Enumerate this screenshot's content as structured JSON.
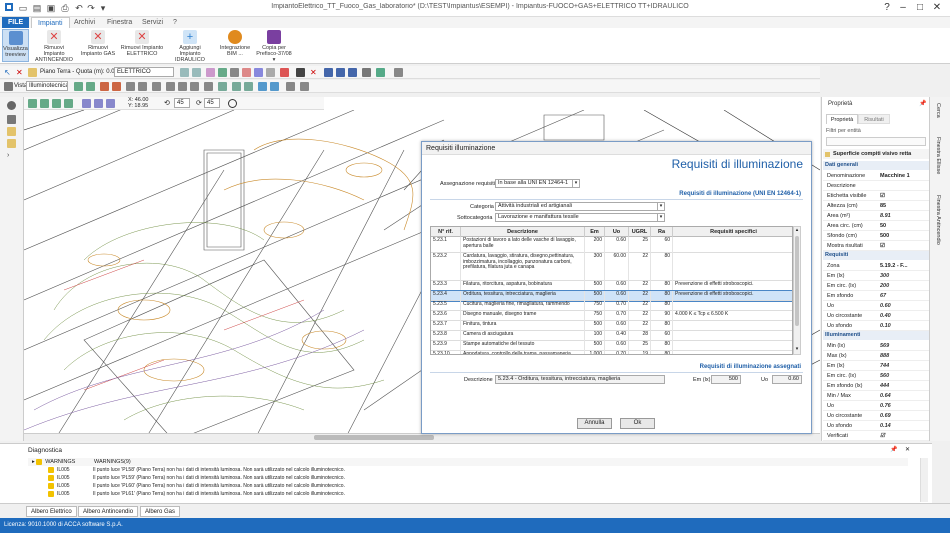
{
  "window": {
    "title": "ImpiantoElettrico_TT_Fuoco_Gas_laboratorio* (D:\\TEST\\Impiantus\\ESEMPI) - Impiantus-FUOCO+GAS+ELETTRICO TT+IDRAULICO"
  },
  "menu": {
    "file": "FILE",
    "tabs": [
      "Impianti",
      "Archivi",
      "Finestra",
      "Servizi",
      "?"
    ]
  },
  "ribbon": [
    {
      "label": "Visualizza treeview",
      "icon": "treeview-icon",
      "color": "#5b8fd0"
    },
    {
      "label": "Rimuovi Impianto ANTINCENDIO",
      "icon": "remove-fire-icon",
      "color": "#d44"
    },
    {
      "label": "Rimuovi Impianto GAS",
      "icon": "remove-gas-icon",
      "color": "#d44"
    },
    {
      "label": "Rimuovi Impianto ELETTRICO",
      "icon": "remove-electric-icon",
      "color": "#d44"
    },
    {
      "label": "Aggiungi Impianto IDRAULICO",
      "icon": "add-water-icon",
      "color": "#2c7fd0"
    },
    {
      "label": "Integrazione BIM ...",
      "icon": "bim-icon",
      "color": "#e08a1e"
    },
    {
      "label": "Copia per Prefisco-37/08 ▾",
      "icon": "copy-icon",
      "color": "#7a3fa0"
    }
  ],
  "toolbar1": {
    "floor": "Piano Terra - Quota (m): 0.00",
    "layer": "ELETTRICO"
  },
  "toolbar2": {
    "view_label": "Vista",
    "view_value": "Illuminotecnica"
  },
  "toolbar3": {
    "coord_x": "X: 46.00",
    "coord_y": "Y: 18.95",
    "angle1": "45",
    "angle2": "45"
  },
  "dialog": {
    "title": "Requisiti illuminazione",
    "heading": "Requisiti di illuminazione",
    "assegnazione_label": "Assegnazione requisiti:",
    "assegnazione_value": "In base alla UNI EN 12464-1",
    "section1": "Requisiti di illuminazione (UNI EN 12464-1)",
    "categoria_label": "Categoria",
    "categoria_value": "Attività industriali ed artigianali",
    "sottocategoria_label": "Sottocategoria",
    "sottocategoria_value": "Lavorazione e manifattura tessile",
    "columns": [
      "N° rif.",
      "Descrizione",
      "Em",
      "Uo",
      "UGRL",
      "Ra",
      "Requisiti specifici"
    ],
    "rows": [
      {
        "rif": "5.23.1",
        "desc": "Postazioni di lavoro a lato delle vasche di lavaggio, apertura balle",
        "em": "200",
        "uo": "0.60",
        "ugrl": "25",
        "ra": "60",
        "req": "",
        "h": 16
      },
      {
        "rif": "5.23.2",
        "desc": "Cardatura, lavaggio, stiratura, disegno,pettinatura, imbozzimatura, incollaggio, punzonatura carboni, prefilatura, filatura juta e canapa",
        "em": "300",
        "uo": "60.00",
        "ugrl": "22",
        "ra": "80",
        "req": "",
        "h": 28
      },
      {
        "rif": "5.23.3",
        "desc": "Filatura, ritorcitura, aspatura, bobinatura",
        "em": "500",
        "uo": "0.60",
        "ugrl": "22",
        "ra": "80",
        "req": "Prevenzione di effetti stroboscopici.",
        "h": 10
      },
      {
        "rif": "5.23.4",
        "desc": "Orditura, tessitura, intrecciatura, maglieria",
        "em": "500",
        "uo": "0.60",
        "ugrl": "22",
        "ra": "80",
        "req": "Prevenzione di effetti stroboscopici.",
        "h": 10,
        "selected": true
      },
      {
        "rif": "5.23.5",
        "desc": "Cucitura, maglieria fine, rimagliatura, rammendo",
        "em": "750",
        "uo": "0.70",
        "ugrl": "22",
        "ra": "80",
        "req": "",
        "h": 10
      },
      {
        "rif": "5.23.6",
        "desc": "Disegno manuale, disegno trame",
        "em": "750",
        "uo": "0.70",
        "ugrl": "22",
        "ra": "90",
        "req": "4.000 K ≤ Tcp ≤ 6.500 K",
        "h": 10
      },
      {
        "rif": "5.23.7",
        "desc": "Finitura, tintura",
        "em": "500",
        "uo": "0.60",
        "ugrl": "22",
        "ra": "80",
        "req": "",
        "h": 10
      },
      {
        "rif": "5.23.8",
        "desc": "Camera di asciugatura",
        "em": "100",
        "uo": "0.40",
        "ugrl": "28",
        "ra": "60",
        "req": "",
        "h": 10
      },
      {
        "rif": "5.23.9",
        "desc": "Stampe automatiche del tessuto",
        "em": "500",
        "uo": "0.60",
        "ugrl": "25",
        "ra": "80",
        "req": "",
        "h": 10
      },
      {
        "rif": "5.23.10",
        "desc": "Annodatura, controllo della trama, passamaneria",
        "em": "1.000",
        "uo": "0.70",
        "ugrl": "19",
        "ra": "80",
        "req": "",
        "h": 10
      }
    ],
    "section2": "Requisiti di illuminazione assegnati",
    "desc_label": "Descrizione",
    "desc_value": "5.23.4 - Orditura, tessitura, intrecciatura, maglieria",
    "em_label": "Em (lx)",
    "em_value": "500",
    "uo_label": "Uo",
    "uo_value": "0.60",
    "cancel": "Annulla",
    "ok": "Ok"
  },
  "props": {
    "title": "Proprietà",
    "tabs": [
      "Proprietà",
      "Risultati"
    ],
    "filter": "Filtri per entità",
    "object": "Superficie compiti visivo retta",
    "sections": [
      {
        "name": "Dati generali",
        "rows": [
          [
            "Denominazione",
            "Macchine 1"
          ],
          [
            "Descrizione",
            ""
          ],
          [
            "Etichetta visibile",
            "☑"
          ],
          [
            "Altezza (cm)",
            "85"
          ],
          [
            "Area (m²)",
            "8.91"
          ],
          [
            "Area circ. (cm)",
            "50"
          ],
          [
            "Sfondo (cm)",
            "500"
          ],
          [
            "Mostra risultati",
            "☑"
          ]
        ]
      },
      {
        "name": "Requisiti",
        "rows": [
          [
            "Zona",
            "5.19.2 - F..."
          ],
          [
            "Em (lx)",
            "300"
          ],
          [
            "Em circ. (lx)",
            "200"
          ],
          [
            "Em sfondo",
            "67"
          ],
          [
            "Uo",
            "0.60"
          ],
          [
            "Uo circostante",
            "0.40"
          ],
          [
            "Uo sfondo",
            "0.10"
          ]
        ]
      },
      {
        "name": "Illuminamenti",
        "rows": [
          [
            "Min (lx)",
            "569"
          ],
          [
            "Max (lx)",
            "888"
          ],
          [
            "Em (lx)",
            "744"
          ],
          [
            "Em circ. (lx)",
            "560"
          ],
          [
            "Em sfondo (lx)",
            "444"
          ],
          [
            "Min / Max",
            "0.64"
          ],
          [
            "Uo",
            "0.76"
          ],
          [
            "Uo circostante",
            "0.69"
          ],
          [
            "Uo sfondo",
            "0.14"
          ],
          [
            "Verificati",
            "☑"
          ]
        ]
      }
    ]
  },
  "vtabs": [
    "Cerca",
    "Finestra Ellisse",
    "Finestra Antincendio"
  ],
  "diagnostics": {
    "title": "Diagnostica",
    "group": "WARNINGS",
    "group_count": "WARNINGS(9)",
    "items": [
      {
        "code": "IL005",
        "msg": "Il punto luce 'PL58' (Piano Terra) non ha i dati di intensità luminosa. Non sarà utilizzato nel calcolo illuminotecnico."
      },
      {
        "code": "IL005",
        "msg": "Il punto luce 'PL59' (Piano Terra) non ha i dati di intensità luminosa. Non sarà utilizzato nel calcolo illuminotecnico."
      },
      {
        "code": "IL005",
        "msg": "Il punto luce 'PL60' (Piano Terra) non ha i dati di intensità luminosa. Non sarà utilizzato nel calcolo illuminotecnico."
      },
      {
        "code": "IL005",
        "msg": "Il punto luce 'PL61' (Piano Terra) non ha i dati di intensità luminosa. Non sarà utilizzato nel calcolo illuminotecnico."
      }
    ]
  },
  "bottomtabs": [
    "Albero Elettrico",
    "Albero Antincendio",
    "Albero Gas"
  ],
  "status": "Licenza: 9010.1000 di ACCA software S.p.A."
}
